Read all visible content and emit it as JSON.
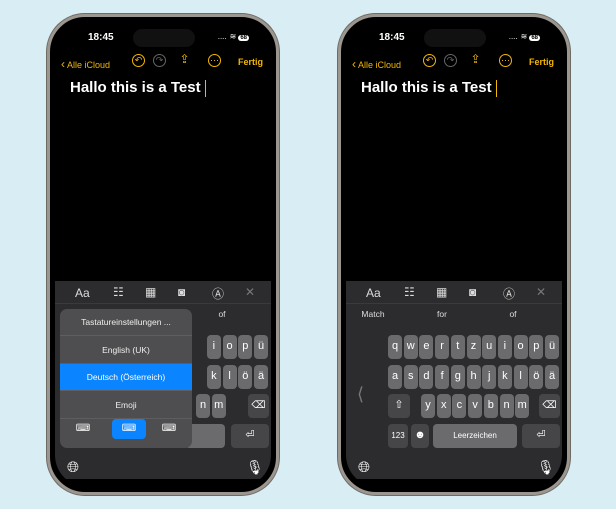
{
  "colors": {
    "accent": "#f2b705",
    "selection": "#0a84ff",
    "background": "#d8edf4"
  },
  "phones": [
    {
      "status": {
        "time": "18:45",
        "signal": "....",
        "battery": "68"
      },
      "nav": {
        "back": "Alle iCloud",
        "done": "Fertig",
        "icons": [
          "chevron-left-icon",
          "undo-icon",
          "redo-icon",
          "share-icon",
          "more-icon"
        ]
      },
      "note_title": "Hallo this is a Test",
      "toolbar": {
        "format": "Aa",
        "icons": [
          "checklist-icon",
          "table-icon",
          "camera-icon",
          "markup-icon",
          "close-icon"
        ]
      },
      "suggestions": [
        "of"
      ],
      "keyboard_menu": {
        "items": [
          "Tastatureinstellungen ...",
          "English (UK)",
          "Deutsch (Österreich)",
          "Emoji"
        ],
        "selected": "Deutsch (Österreich)",
        "layout_icons": [
          "keyboard-left-icon",
          "keyboard-full-icon",
          "keyboard-right-icon"
        ],
        "selected_layout": "keyboard-full-icon"
      },
      "rows": [
        [
          "i",
          "o",
          "p",
          "ü"
        ],
        [
          "k",
          "l",
          "ö",
          "ä"
        ],
        [
          "n",
          "m"
        ]
      ]
    },
    {
      "status": {
        "time": "18:45",
        "signal": "....",
        "battery": "68"
      },
      "nav": {
        "back": "Alle iCloud",
        "done": "Fertig",
        "icons": [
          "chevron-left-icon",
          "undo-icon",
          "redo-icon",
          "share-icon",
          "more-icon"
        ]
      },
      "note_title": "Hallo this is a Test",
      "toolbar": {
        "format": "Aa",
        "icons": [
          "checklist-icon",
          "table-icon",
          "camera-icon",
          "markup-icon",
          "close-icon"
        ]
      },
      "suggestions": [
        "Match",
        "for",
        "of"
      ],
      "rows": [
        [
          "q",
          "w",
          "e",
          "r",
          "t",
          "z",
          "u",
          "i",
          "o",
          "p",
          "ü"
        ],
        [
          "a",
          "s",
          "d",
          "f",
          "g",
          "h",
          "j",
          "k",
          "l",
          "ö",
          "ä"
        ],
        [
          "y",
          "x",
          "c",
          "v",
          "b",
          "n",
          "m"
        ]
      ],
      "numbers_key": "123",
      "space_key": "Leerzeichen"
    }
  ]
}
